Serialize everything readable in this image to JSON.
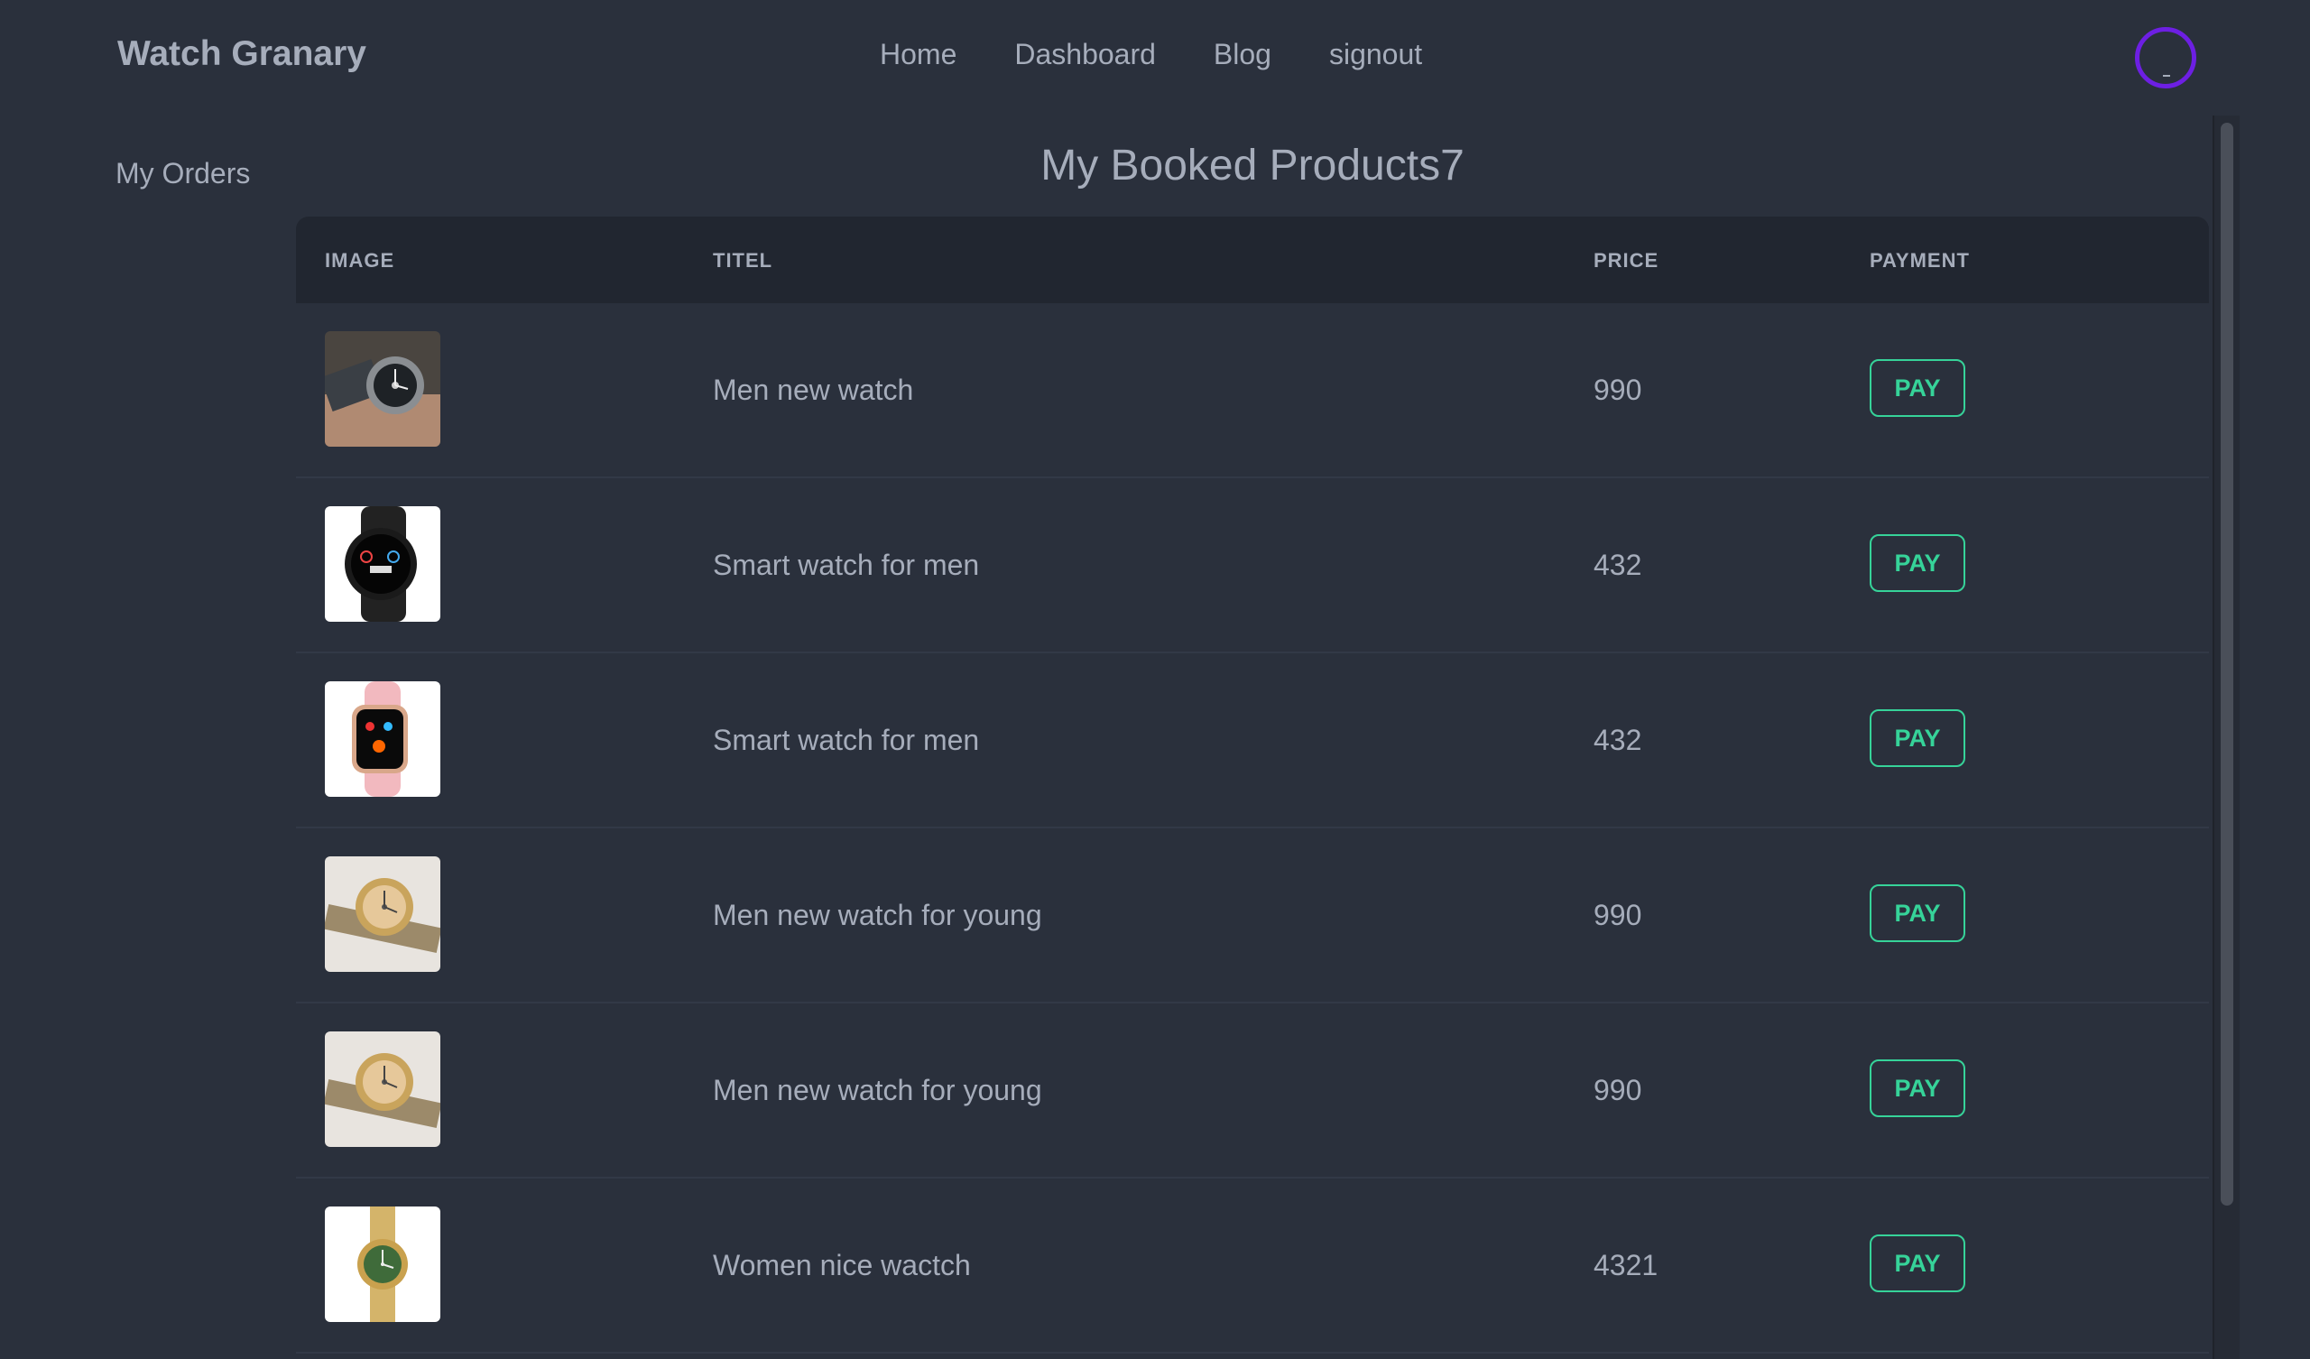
{
  "navbar": {
    "brand": "Watch Granary",
    "links": [
      "Home",
      "Dashboard",
      "Blog",
      "signout"
    ]
  },
  "sidebar": {
    "link": "My Orders"
  },
  "main": {
    "title": "My Booked Products7",
    "columns": [
      "IMAGE",
      "TITEL",
      "PRICE",
      "PAYMENT"
    ],
    "rows": [
      {
        "title": "Men new watch",
        "price": "990",
        "action": "PAY",
        "image_icon": "steel-watch-on-wrist-photo"
      },
      {
        "title": "Smart watch for men",
        "price": "432",
        "action": "PAY",
        "image_icon": "black-round-smartwatch-photo"
      },
      {
        "title": "Smart watch for men",
        "price": "432",
        "action": "PAY",
        "image_icon": "pink-square-smartwatch-photo"
      },
      {
        "title": "Men new watch for young",
        "price": "990",
        "action": "PAY",
        "image_icon": "two-tone-gold-watch-photo"
      },
      {
        "title": "Men new watch for young",
        "price": "990",
        "action": "PAY",
        "image_icon": "two-tone-gold-watch-photo"
      },
      {
        "title": "Women nice wactch",
        "price": "4321",
        "action": "PAY",
        "image_icon": "gold-green-dial-watch-photo"
      }
    ]
  },
  "colors": {
    "background": "#2a303c",
    "header_row": "#212630",
    "text": "#a6adbb",
    "pay_accent": "#36d399",
    "avatar_ring": "#6d1fe3"
  }
}
